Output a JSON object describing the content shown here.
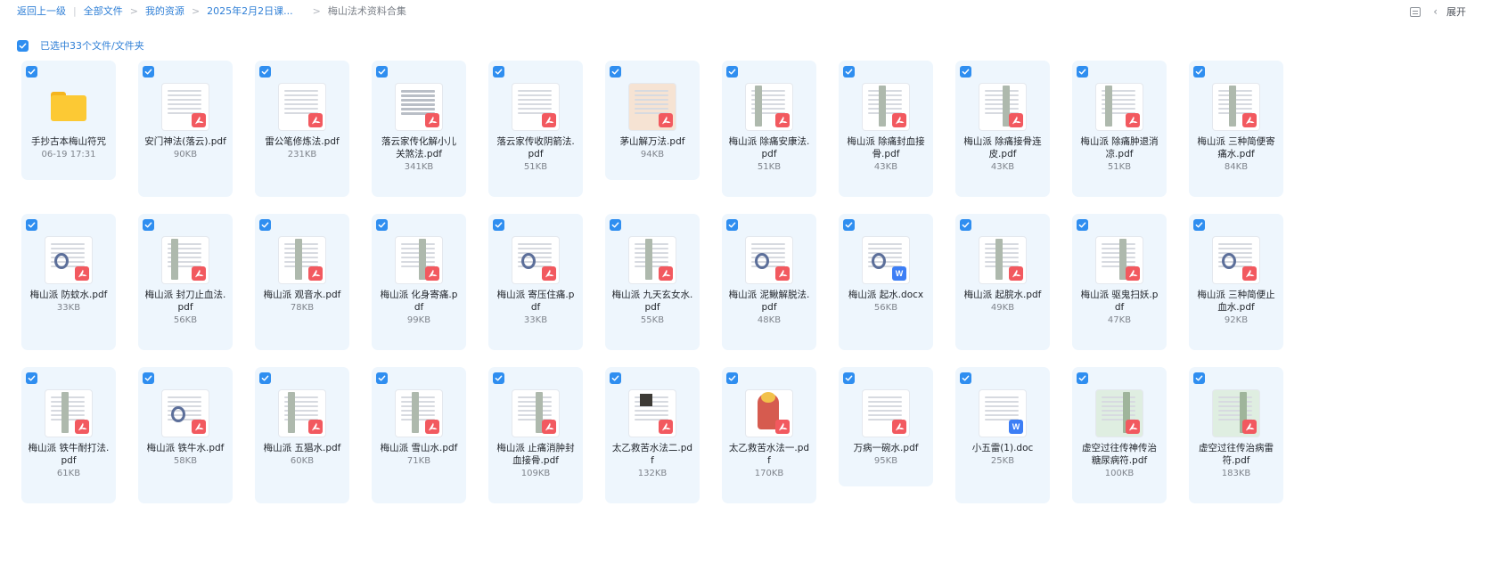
{
  "breadcrumb": {
    "back": "返回上一级",
    "items": [
      "全部文件",
      "我的资源",
      "2025年2月2日课..."
    ],
    "current": "梅山法术资料合集"
  },
  "toolbar": {
    "expand_label": "展开"
  },
  "selection": {
    "text": "已选中33个文件/文件夹"
  },
  "colors": {
    "accent": "#2f8ef0",
    "card_bg": "#eef6fd",
    "pdf_badge": "#f2595f",
    "doc_badge": "#3d7ef5",
    "folder": "#fcc934"
  },
  "files": [
    {
      "name": "手抄古本梅山符咒",
      "meta": "06-19 17:31",
      "type": "folder",
      "thumb": "folder"
    },
    {
      "name": "安门神法(落云).pdf",
      "meta": "90KB",
      "type": "pdf",
      "thumb": "doc"
    },
    {
      "name": "雷公笔修炼法.pdf",
      "meta": "231KB",
      "type": "pdf",
      "thumb": "doc"
    },
    {
      "name": "落云家传化解小儿关煞法.pdf",
      "meta": "341KB",
      "type": "pdf",
      "thumb": "table"
    },
    {
      "name": "落云家传收阴箭法.pdf",
      "meta": "51KB",
      "type": "pdf",
      "thumb": "doc"
    },
    {
      "name": "茅山解万法.pdf",
      "meta": "94KB",
      "type": "pdf",
      "thumb": "peach"
    },
    {
      "name": "梅山派 除痛安康法.pdf",
      "meta": "51KB",
      "type": "pdf",
      "thumb": "strip"
    },
    {
      "name": "梅山派 除痛封血接骨.pdf",
      "meta": "43KB",
      "type": "pdf",
      "thumb": "strip"
    },
    {
      "name": "梅山派 除痛接骨连皮.pdf",
      "meta": "43KB",
      "type": "pdf",
      "thumb": "strip"
    },
    {
      "name": "梅山派 除痛肿退消凉.pdf",
      "meta": "51KB",
      "type": "pdf",
      "thumb": "strip"
    },
    {
      "name": "梅山派 三种简便寄痛水.pdf",
      "meta": "84KB",
      "type": "pdf",
      "thumb": "strip"
    },
    {
      "name": "梅山派 防蚊水.pdf",
      "meta": "33KB",
      "type": "pdf",
      "thumb": "stamp"
    },
    {
      "name": "梅山派 封刀止血法.pdf",
      "meta": "56KB",
      "type": "pdf",
      "thumb": "strip"
    },
    {
      "name": "梅山派 观音水.pdf",
      "meta": "78KB",
      "type": "pdf",
      "thumb": "strip"
    },
    {
      "name": "梅山派 化身寄痛.pdf",
      "meta": "99KB",
      "type": "pdf",
      "thumb": "strip"
    },
    {
      "name": "梅山派 寄压住痛.pdf",
      "meta": "33KB",
      "type": "pdf",
      "thumb": "stamp"
    },
    {
      "name": "梅山派 九天玄女水.pdf",
      "meta": "55KB",
      "type": "pdf",
      "thumb": "strip"
    },
    {
      "name": "梅山派 泥鳅解脱法.pdf",
      "meta": "48KB",
      "type": "pdf",
      "thumb": "stamp"
    },
    {
      "name": "梅山派 起水.docx",
      "meta": "56KB",
      "type": "doc",
      "thumb": "stamp"
    },
    {
      "name": "梅山派 起脘水.pdf",
      "meta": "49KB",
      "type": "pdf",
      "thumb": "strip"
    },
    {
      "name": "梅山派 驱鬼扫妖.pdf",
      "meta": "47KB",
      "type": "pdf",
      "thumb": "strip"
    },
    {
      "name": "梅山派 三种简便止血水.pdf",
      "meta": "92KB",
      "type": "pdf",
      "thumb": "stamp"
    },
    {
      "name": "梅山派 铁牛耐打法.pdf",
      "meta": "61KB",
      "type": "pdf",
      "thumb": "strip"
    },
    {
      "name": "梅山派 铁牛水.pdf",
      "meta": "58KB",
      "type": "pdf",
      "thumb": "stamp"
    },
    {
      "name": "梅山派 五猖水.pdf",
      "meta": "60KB",
      "type": "pdf",
      "thumb": "strip"
    },
    {
      "name": "梅山派 雪山水.pdf",
      "meta": "71KB",
      "type": "pdf",
      "thumb": "strip"
    },
    {
      "name": "梅山派 止痛消肿封血接骨.pdf",
      "meta": "109KB",
      "type": "pdf",
      "thumb": "strip"
    },
    {
      "name": "太乙救苦水法二.pdf",
      "meta": "132KB",
      "type": "pdf",
      "thumb": "photo"
    },
    {
      "name": "太乙救苦水法一.pdf",
      "meta": "170KB",
      "type": "pdf",
      "thumb": "figure"
    },
    {
      "name": "万病一碗水.pdf",
      "meta": "95KB",
      "type": "pdf",
      "thumb": "doc"
    },
    {
      "name": "小五雷(1).doc",
      "meta": "25KB",
      "type": "doc",
      "thumb": "doc"
    },
    {
      "name": "虚空过往传神传治糖尿病符.pdf",
      "meta": "100KB",
      "type": "pdf",
      "thumb": "green"
    },
    {
      "name": "虚空过往传治病雷符.pdf",
      "meta": "183KB",
      "type": "pdf",
      "thumb": "green"
    }
  ]
}
